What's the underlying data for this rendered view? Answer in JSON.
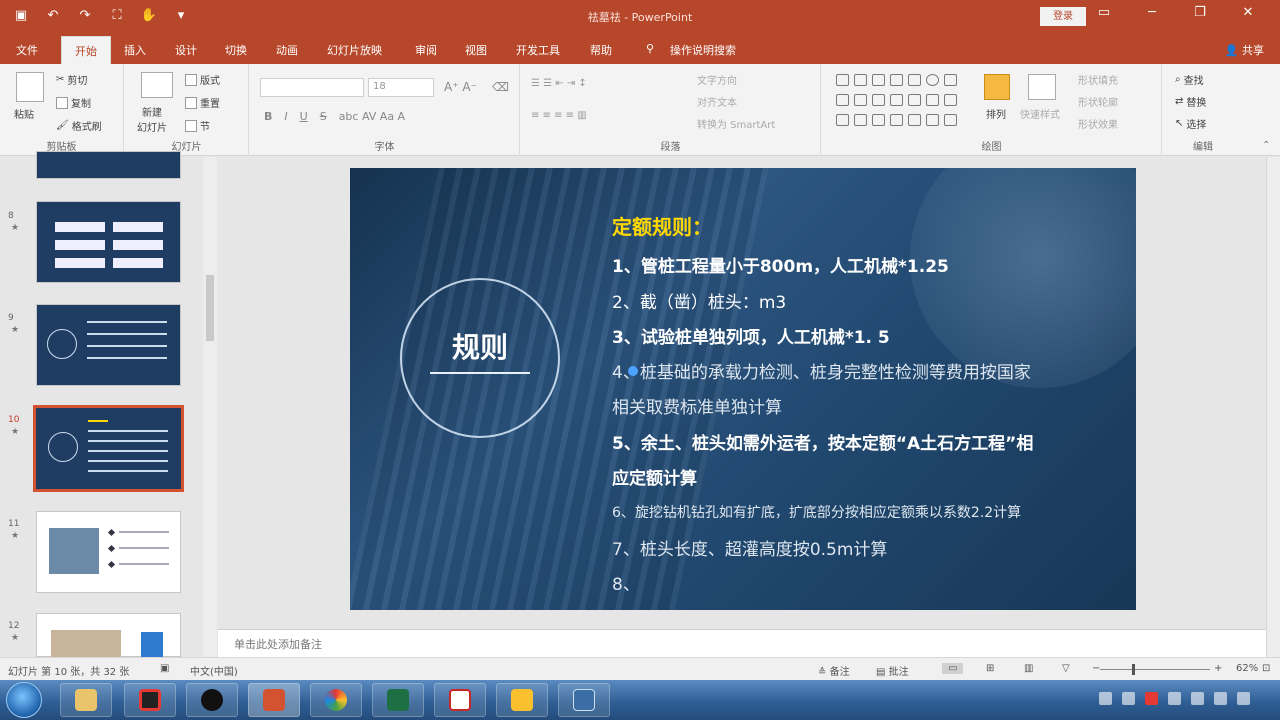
{
  "titlebar": {
    "doc_title": "祛墓祛 - PowerPoint",
    "login": "登录"
  },
  "tabs": [
    "文件",
    "开始",
    "插入",
    "设计",
    "切换",
    "动画",
    "幻灯片放映",
    "审阅",
    "视图",
    "开发工具",
    "帮助",
    "操作说明搜索"
  ],
  "share": "共享",
  "ribbon": {
    "clipboard": {
      "paste": "粘贴",
      "cut": "剪切",
      "copy": "复制",
      "format_painter": "格式刷",
      "label": "剪贴板"
    },
    "slides": {
      "new_slide": "新建\n幻灯片",
      "layout": "版式",
      "reset": "重置",
      "section": "节",
      "label": "幻灯片"
    },
    "font": {
      "size": "18",
      "label": "字体"
    },
    "paragraph": {
      "text_direction": "文字方向",
      "align_text": "对齐文本",
      "smartart": "转换为 SmartArt",
      "label": "段落"
    },
    "drawing": {
      "arrange": "排列",
      "quick_styles": "快速样式",
      "shape_fill": "形状填充",
      "shape_outline": "形状轮廓",
      "shape_effects": "形状效果",
      "label": "绘图"
    },
    "editing": {
      "find": "查找",
      "replace": "替换",
      "select": "选择",
      "label": "编辑"
    }
  },
  "thumbnails": [
    {
      "num": "",
      "kind": "dark"
    },
    {
      "num": "8",
      "kind": "dark"
    },
    {
      "num": "9",
      "kind": "dark"
    },
    {
      "num": "10",
      "kind": "dark-selected"
    },
    {
      "num": "11",
      "kind": "light"
    },
    {
      "num": "12",
      "kind": "light"
    }
  ],
  "slide": {
    "circle_title": "规则",
    "heading": "定额规则：",
    "lines": [
      "1、管桩工程量小于800m，人工机械*1.25",
      "2、截（凿）桩头：m3",
      "3、试验桩单独列项，人工机械*1. 5",
      "4、桩基础的承载力检测、桩身完整性检测等费用按国家",
      "相关取费标准单独计算",
      "5、余土、桩头如需外运者，按本定额“A土石方工程”相",
      "应定额计算",
      "6、旋挖钻机钻孔如有扩底，扩底部分按相应定额乘以系数2.2计算",
      "7、桩头长度、超灌高度按0.5m计算",
      "8、"
    ]
  },
  "notes_placeholder": "单击此处添加备注",
  "status": {
    "slide_info": "幻灯片 第 10 张，共 32 张",
    "language": "中文(中国)",
    "notes_btn": "备注",
    "comments_btn": "批注",
    "zoom": "62%"
  }
}
